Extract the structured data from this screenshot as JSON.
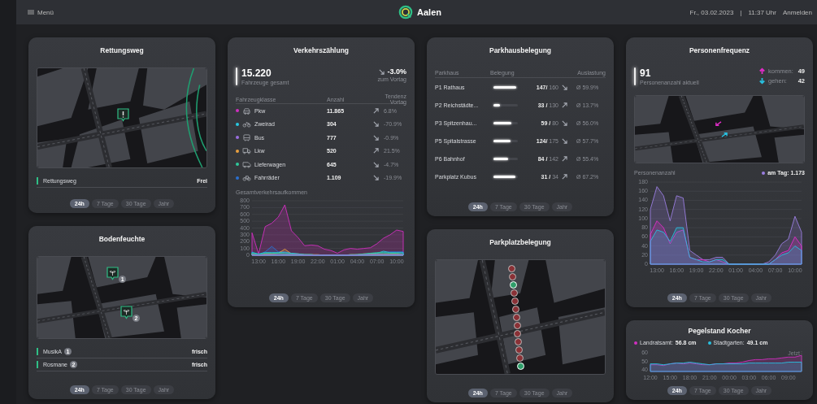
{
  "header": {
    "menu": "Menü",
    "title": "Aalen",
    "date": "Fr., 03.02.2023",
    "separator": "|",
    "time": "11:37 Uhr",
    "login": "Anmelden"
  },
  "cards": [
    {
      "kind": "map_status",
      "title": "Rettungsweg",
      "rows": [
        {
          "label": "Rettungsweg",
          "value": "Frei"
        }
      ],
      "ranges": [
        {
          "label": "24h",
          "selected": true
        },
        {
          "label": "7 Tage",
          "selected": false
        },
        {
          "label": "30 Tage",
          "selected": false
        },
        {
          "label": "Jahr",
          "selected": false
        }
      ]
    },
    {
      "kind": "traffic",
      "title": "Verkehrszählung",
      "total": "15.220",
      "total_label": "Fahrzeuge gesamt",
      "rising": false,
      "change": "-3.0%",
      "change_label": "zum Vortag",
      "columns": [
        "Fahrzeugklasse",
        "Anzahl",
        "Tendenz Vortag"
      ],
      "rows": [
        {
          "kind": "car",
          "color": "#d02fc0",
          "name": "Pkw",
          "count": "11.865",
          "rising": true,
          "change": "6.8%"
        },
        {
          "kind": "motorbike",
          "color": "#28c8e0",
          "name": "Zweirad",
          "count": "304",
          "rising": false,
          "change": "-70.9%"
        },
        {
          "kind": "bus",
          "color": "#9a6ee0",
          "name": "Bus",
          "count": "777",
          "rising": false,
          "change": "-0.9%"
        },
        {
          "kind": "truck",
          "color": "#e8a040",
          "name": "Lkw",
          "count": "520",
          "rising": true,
          "change": "21.5%"
        },
        {
          "kind": "van",
          "color": "#2fc89a",
          "name": "Lieferwagen",
          "count": "645",
          "rising": false,
          "change": "-4.7%"
        },
        {
          "kind": "bicycle",
          "color": "#2a70d0",
          "name": "Fahrräder",
          "count": "1.109",
          "rising": false,
          "change": "-19.9%"
        }
      ],
      "chart_title": "Gesamtverkehrsaufkommen",
      "chart_data": {
        "type": "area",
        "categories": [
          null,
          "13:00",
          null,
          null,
          "16:00",
          null,
          null,
          "19:00",
          null,
          null,
          "22:00",
          null,
          null,
          "01:00",
          null,
          null,
          "04:00",
          null,
          null,
          "07:00",
          null,
          null,
          "10:00",
          null
        ],
        "series": [
          {
            "color": "#d02fc0",
            "values": [
              330,
              20,
              420,
              470,
              560,
              740,
              360,
              260,
              140,
              150,
              140,
              90,
              70,
              30,
              80,
              100,
              90,
              100,
              110,
              170,
              250,
              300,
              370,
              350
            ]
          },
          {
            "color": "#2a70d0",
            "values": [
              50,
              10,
              50,
              130,
              50,
              50,
              30,
              20,
              10,
              0,
              0,
              0,
              0,
              0,
              0,
              0,
              0,
              10,
              20,
              30,
              40,
              50,
              50,
              50
            ]
          },
          {
            "color": "#e8a040",
            "values": [
              20,
              0,
              20,
              20,
              30,
              90,
              20,
              20,
              10,
              10,
              10,
              0,
              0,
              0,
              0,
              10,
              10,
              20,
              20,
              20,
              20,
              20,
              20,
              10
            ]
          },
          {
            "color": "#28c8e0",
            "values": [
              40,
              20,
              40,
              40,
              40,
              40,
              30,
              20,
              10,
              10,
              0,
              0,
              0,
              0,
              0,
              0,
              10,
              10,
              30,
              30,
              60,
              40,
              40,
              40
            ]
          },
          {
            "color": "#2fc89a",
            "values": [
              30,
              10,
              30,
              30,
              30,
              20,
              20,
              10,
              10,
              10,
              0,
              0,
              0,
              0,
              0,
              10,
              10,
              20,
              30,
              40,
              40,
              30,
              30,
              20
            ]
          },
          {
            "color": "#9a6ee0",
            "values": [
              10,
              0,
              10,
              10,
              10,
              10,
              10,
              10,
              0,
              0,
              0,
              0,
              0,
              0,
              0,
              0,
              0,
              10,
              10,
              10,
              10,
              10,
              10,
              10
            ]
          }
        ],
        "ylim": [
          0,
          800
        ],
        "grid": true,
        "yticks": [
          0,
          100,
          200,
          300,
          400,
          500,
          600,
          700,
          800
        ]
      },
      "ranges": [
        {
          "label": "24h",
          "selected": true
        },
        {
          "label": "7 Tage",
          "selected": false
        },
        {
          "label": "30 Tage",
          "selected": false
        },
        {
          "label": "Jahr",
          "selected": false
        }
      ]
    },
    {
      "kind": "parking_garage",
      "title": "Parkhausbelegung",
      "columns": [
        "Parkhaus",
        "Belegung",
        "Auslastung"
      ],
      "rows": [
        {
          "name": "P1 Rathaus",
          "level": 0.92,
          "occupancy": "**147/** 160",
          "rising": false,
          "average": "Ø 59.9%"
        },
        {
          "name": "P2 Reichstädte...",
          "level": 0.25,
          "occupancy": "**33 /** 130",
          "rising": true,
          "average": "Ø 13.7%"
        },
        {
          "name": "P3 Spitzenhau...",
          "level": 0.74,
          "occupancy": "**59 /** 80",
          "rising": false,
          "average": "Ø 56.0%"
        },
        {
          "name": "P5 Spitalstrasse",
          "level": 0.71,
          "occupancy": "**124/** 175",
          "rising": false,
          "average": "Ø 57.7%"
        },
        {
          "name": "P6 Bahnhof",
          "level": 0.59,
          "occupancy": "**84 /** 142",
          "rising": true,
          "average": "Ø 55.4%"
        },
        {
          "name": "Parkplatz Kubus",
          "level": 0.91,
          "occupancy": "**31 /** 34",
          "rising": true,
          "average": "Ø 67.2%"
        }
      ],
      "ranges": [
        {
          "label": "24h",
          "selected": true
        },
        {
          "label": "7 Tage",
          "selected": false
        },
        {
          "label": "30 Tage",
          "selected": false
        },
        {
          "label": "Jahr",
          "selected": false
        }
      ]
    },
    {
      "kind": "people",
      "title": "Personenfrequenz",
      "current": "91",
      "current_label": "Personenanzahl aktuell",
      "flows": [
        {
          "kind": "in",
          "label": "kommen:",
          "value": "49",
          "color": "#e02cc8"
        },
        {
          "kind": "out",
          "label": "gehen:",
          "value": "42",
          "color": "#28c0e0"
        }
      ],
      "chart_title": "Personenanzahl",
      "legend": {
        "label": "am Tag: 1.173",
        "color": "#9a7ee0"
      },
      "chart_data": {
        "type": "area",
        "categories": [
          null,
          "13:00",
          null,
          null,
          "16:00",
          null,
          null,
          "19:00",
          null,
          null,
          "22:00",
          null,
          null,
          "01:00",
          null,
          null,
          "04:00",
          null,
          null,
          "07:00",
          null,
          null,
          "10:00",
          null
        ],
        "series": [
          {
            "color": "#9a7ee0",
            "values": [
              120,
              170,
              150,
              95,
              150,
              145,
              30,
              20,
              10,
              10,
              15,
              15,
              0,
              0,
              0,
              0,
              0,
              0,
              5,
              20,
              45,
              55,
              105,
              70
            ]
          },
          {
            "color": "#e02cc8",
            "values": [
              65,
              95,
              80,
              45,
              70,
              75,
              15,
              10,
              10,
              5,
              10,
              5,
              0,
              0,
              0,
              0,
              0,
              0,
              0,
              10,
              25,
              30,
              60,
              40
            ]
          },
          {
            "color": "#28c0e0",
            "values": [
              50,
              75,
              70,
              50,
              80,
              80,
              15,
              10,
              5,
              5,
              10,
              10,
              0,
              0,
              0,
              0,
              0,
              0,
              0,
              10,
              20,
              25,
              40,
              30
            ]
          }
        ],
        "ylim": [
          0,
          180
        ],
        "grid": true,
        "yticks": [
          0,
          20,
          40,
          60,
          80,
          100,
          120,
          140,
          160,
          180
        ]
      },
      "ranges": [
        {
          "label": "24h",
          "selected": true
        },
        {
          "label": "7 Tage",
          "selected": false
        },
        {
          "label": "30 Tage",
          "selected": false
        },
        {
          "label": "Jahr",
          "selected": false
        }
      ]
    },
    {
      "kind": "soil",
      "title": "Bodenfeuchte",
      "markers": [
        {
          "badge": "1"
        },
        {
          "badge": "2"
        }
      ],
      "rows": [
        {
          "name": "MusikA",
          "badge": "1",
          "value": "frisch"
        },
        {
          "name": "Rosmane",
          "badge": "2",
          "value": "frisch"
        }
      ],
      "ranges": [
        {
          "label": "24h",
          "selected": true
        },
        {
          "label": "7 Tage",
          "selected": false
        },
        {
          "label": "30 Tage",
          "selected": false
        },
        {
          "label": "Jahr",
          "selected": false
        }
      ]
    },
    {
      "kind": "parking_lot",
      "title": "Parkplatzbelegung",
      "spots": [
        {
          "occupied": true
        },
        {
          "occupied": true
        },
        {
          "occupied": false
        },
        {
          "occupied": true
        },
        {
          "occupied": true
        },
        {
          "occupied": true
        },
        {
          "occupied": true
        },
        {
          "occupied": true
        },
        {
          "occupied": true
        },
        {
          "occupied": true
        },
        {
          "occupied": true
        },
        {
          "occupied": true
        },
        {
          "occupied": false
        }
      ],
      "ranges": [
        {
          "label": "24h",
          "selected": true
        },
        {
          "label": "7 Tage",
          "selected": false
        },
        {
          "label": "30 Tage",
          "selected": false
        },
        {
          "label": "Jahr",
          "selected": false
        }
      ]
    },
    {
      "kind": "water",
      "title": "Pegelstand Kocher",
      "legend": [
        {
          "label": "Landratsamt:",
          "value": "56.8 cm",
          "color": "#d02fc0"
        },
        {
          "label": "Stadtgarten:",
          "value": "49.1 cm",
          "color": "#28c0e0"
        }
      ],
      "chart_data": {
        "type": "area",
        "categories": [
          "12:00",
          null,
          null,
          "15:00",
          null,
          null,
          "18:00",
          null,
          null,
          "21:00",
          null,
          null,
          "00:00",
          null,
          null,
          "03:00",
          null,
          null,
          "06:00",
          null,
          null,
          "09:00",
          null,
          null
        ],
        "series": [
          {
            "color": "#d02fc0",
            "values": [
              46,
              46,
              45,
              47,
              48,
              47,
              48,
              47,
              46,
              46,
              47,
              47,
              48,
              48,
              49,
              51,
              52,
              52,
              53,
              53,
              54,
              55,
              55,
              57
            ]
          },
          {
            "color": "#28c0e0",
            "values": [
              47,
              47,
              46,
              47,
              48,
              48,
              49,
              48,
              47,
              46,
              47,
              47,
              47,
              47,
              47,
              48,
              48,
              48,
              48,
              48,
              48,
              49,
              49,
              49
            ]
          }
        ],
        "ylim": [
          38,
          62
        ],
        "grid": false,
        "yticks": [
          40,
          50,
          60
        ],
        "annotations": [
          {
            "text": "Jetzt"
          }
        ]
      },
      "ranges": [
        {
          "label": "24h",
          "selected": true
        },
        {
          "label": "7 Tage",
          "selected": false
        },
        {
          "label": "30 Tage",
          "selected": false
        },
        {
          "label": "Jahr",
          "selected": false
        }
      ]
    }
  ]
}
